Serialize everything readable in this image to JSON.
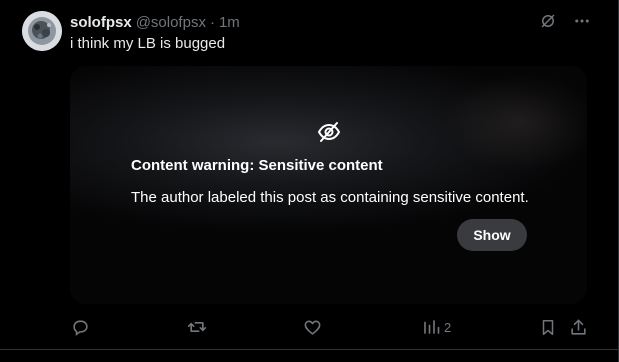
{
  "post": {
    "display_name": "solofpsx",
    "handle": "@solofpsx",
    "separator": "·",
    "time": "1m",
    "text": "i think my LB is bugged"
  },
  "media": {
    "warning_title": "Content warning: Sensitive content",
    "warning_body": "The author labeled this post as containing sensitive content.",
    "show_label": "Show"
  },
  "actions": {
    "views_count": "2"
  },
  "icons": {
    "top": [
      "grok-icon",
      "more-icon"
    ],
    "media": [
      "eye-slash-icon"
    ],
    "actions": [
      "reply-icon",
      "repost-icon",
      "like-icon",
      "views-icon",
      "bookmark-icon",
      "share-icon"
    ]
  },
  "colors": {
    "background": "#000000",
    "text_primary": "#e7e9ea",
    "text_secondary": "#71767b",
    "divider": "#2f3336",
    "show_button": "#3a3b3e"
  }
}
